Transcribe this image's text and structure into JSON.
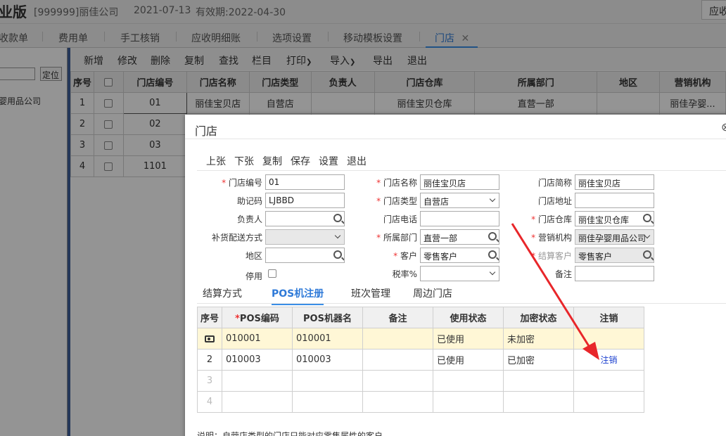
{
  "header": {
    "title": "业版",
    "company": "[999999]丽佳公司",
    "date": "2021-07-13",
    "valid": "有效期:2022-04-30",
    "right_button": "应收"
  },
  "tabs": [
    "收款单",
    "费用单",
    "手工核销",
    "应收明细账",
    "选项设置",
    "移动模板设置"
  ],
  "active_tab": "门店",
  "left_panel": {
    "locate_button": "定位",
    "tree_item": "婴用品公司"
  },
  "toolbar": [
    "新增",
    "修改",
    "删除",
    "复制",
    "查找",
    "栏目",
    "打印",
    "导入",
    "导出",
    "退出"
  ],
  "grid": {
    "columns": [
      "序号",
      "",
      "门店编号",
      "门店名称",
      "门店类型",
      "负责人",
      "门店仓库",
      "所属部门",
      "地区",
      "营销机构"
    ],
    "rows": [
      {
        "no": "1",
        "code": "01",
        "name": "丽佳宝贝店",
        "type": "自营店",
        "manager": "",
        "warehouse": "丽佳宝贝仓库",
        "dept": "直营一部",
        "region": "",
        "org": "丽佳孕婴..."
      },
      {
        "no": "2",
        "code": "02"
      },
      {
        "no": "3",
        "code": "03"
      },
      {
        "no": "4",
        "code": "1101"
      }
    ]
  },
  "modal": {
    "title": "门店",
    "close_icon": "×",
    "toolbar": [
      "上张",
      "下张",
      "复制",
      "保存",
      "设置",
      "退出"
    ],
    "fields": {
      "store_code_label": "门店编号",
      "store_code": "01",
      "store_name_label": "门店名称",
      "store_name": "丽佳宝贝店",
      "store_short_label": "门店简称",
      "store_short": "丽佳宝贝店",
      "mnemonic_label": "助记码",
      "mnemonic": "LJBBD",
      "store_type_label": "门店类型",
      "store_type": "自营店",
      "store_addr_label": "门店地址",
      "store_addr": "",
      "manager_label": "负责人",
      "manager": "",
      "store_phone_label": "门店电话",
      "store_phone": "",
      "warehouse_label": "门店仓库",
      "warehouse": "丽佳宝贝仓库",
      "replenish_label": "补货配送方式",
      "replenish": "",
      "dept_label": "所属部门",
      "dept": "直营一部",
      "org_label": "营销机构",
      "org": "丽佳孕婴用品公司",
      "region_label": "地区",
      "region": "",
      "customer_label": "客户",
      "customer": "零售客户",
      "settle_customer_label": "结算客户",
      "settle_customer": "零售客户",
      "disable_label": "停用",
      "tax_label": "税率%",
      "tax": "",
      "remark_label": "备注",
      "remark": ""
    },
    "subtabs": [
      "结算方式",
      "POS机注册",
      "班次管理",
      "周边门店"
    ],
    "pos_table": {
      "columns": [
        "序号",
        "POS编码",
        "POS机器名",
        "备注",
        "使用状态",
        "加密状态",
        "注销"
      ],
      "rows": [
        {
          "no": "",
          "code": "010001",
          "name": "010001",
          "remark": "",
          "use": "已使用",
          "enc": "未加密",
          "cancel": ""
        },
        {
          "no": "2",
          "code": "010003",
          "name": "010003",
          "remark": "",
          "use": "已使用",
          "enc": "已加密",
          "cancel": "注销"
        },
        {
          "no": "3"
        },
        {
          "no": "4"
        }
      ]
    },
    "note": "说明：自营店类型的门店只能对应零售属性的客户"
  },
  "colors": {
    "accent": "#3a8ee6",
    "required": "#e33",
    "arrow": "#e8262a",
    "link": "#1a3fcf"
  }
}
